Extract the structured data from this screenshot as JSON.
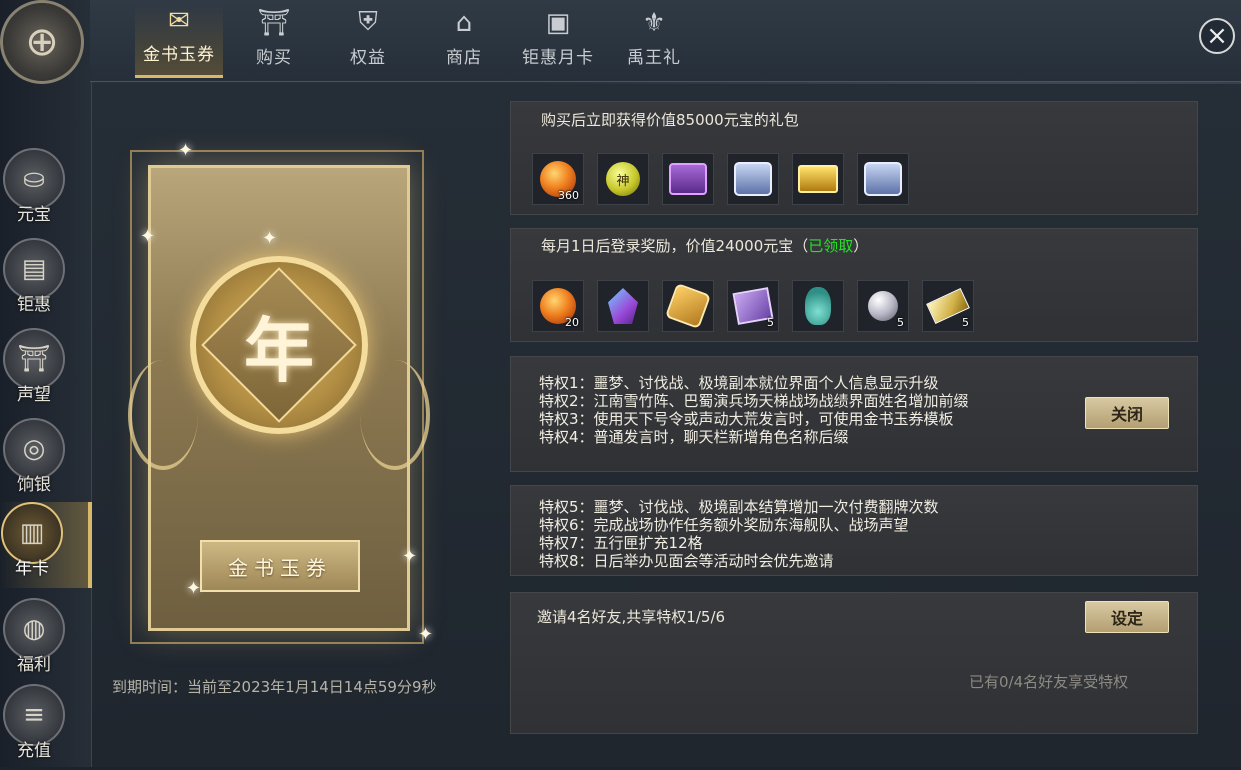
{
  "tabs": [
    {
      "label": "金书玉券",
      "icon": "scroll-icon",
      "glyph": "✉"
    },
    {
      "label": "购买",
      "icon": "gate-icon",
      "glyph": "⛩"
    },
    {
      "label": "权益",
      "icon": "shield-icon",
      "glyph": "⛨"
    },
    {
      "label": "商店",
      "icon": "shop-icon",
      "glyph": "⌂"
    },
    {
      "label": "钜惠月卡",
      "icon": "card-icon",
      "glyph": "▣"
    },
    {
      "label": "禹王礼",
      "icon": "crest-icon",
      "glyph": "⚜"
    }
  ],
  "sidebar": [
    {
      "label": "元宝",
      "icon": "ingot-icon",
      "glyph": "⛀"
    },
    {
      "label": "钜惠",
      "icon": "giftbox-icon",
      "glyph": "▤"
    },
    {
      "label": "声望",
      "icon": "pavilion-icon",
      "glyph": "⛩"
    },
    {
      "label": "饷银",
      "icon": "coin-icon",
      "glyph": "◎"
    },
    {
      "label": "年卡",
      "icon": "card-icon",
      "glyph": "▥"
    },
    {
      "label": "福利",
      "icon": "pouch-icon",
      "glyph": "◍"
    },
    {
      "label": "充值",
      "icon": "coin-stack-icon",
      "glyph": "≡"
    }
  ],
  "card": {
    "center_char": "年",
    "plaque": "金书玉券"
  },
  "expire_text": "到期时间：当前至2023年1月14日14点59分9秒",
  "gift_panel": {
    "title": "购买后立即获得价值85000元宝的礼包",
    "items": [
      {
        "icon": "fire-orb-icon",
        "count": "360"
      },
      {
        "icon": "god-orb-icon",
        "count": "",
        "char": "神"
      },
      {
        "icon": "purple-chest-icon",
        "count": ""
      },
      {
        "icon": "blue-chest-icon",
        "count": ""
      },
      {
        "icon": "gold-chest-icon",
        "count": ""
      },
      {
        "icon": "blue-chest-icon",
        "count": ""
      }
    ]
  },
  "monthly_panel": {
    "title_prefix": "每月1日后登录奖励，价值24000元宝（",
    "status": "已领取",
    "title_suffix": "）",
    "items": [
      {
        "icon": "fire-orb-icon",
        "count": "20"
      },
      {
        "icon": "crystal-icon",
        "count": ""
      },
      {
        "icon": "gold-token-icon",
        "count": ""
      },
      {
        "icon": "purple-scroll-icon",
        "count": "5"
      },
      {
        "icon": "jade-vase-icon",
        "count": ""
      },
      {
        "icon": "pearl-icon",
        "count": "5"
      },
      {
        "icon": "gold-bar-icon",
        "count": "5"
      }
    ]
  },
  "privileges_a": {
    "lines": [
      "特权1：噩梦、讨伐战、极境副本就位界面个人信息显示升级",
      "特权2：江南雪竹阵、巴蜀演兵场天梯战场战绩界面姓名增加前缀",
      "特权3：使用天下号令或声动大荒发言时，可使用金书玉券模板",
      "特权4：普通发言时，聊天栏新增角色名称后缀"
    ],
    "button": "关闭"
  },
  "privileges_b": {
    "lines": [
      "特权5：噩梦、讨伐战、极境副本结算增加一次付费翻牌次数",
      "特权6：完成战场协作任务额外奖励东海舰队、战场声望",
      "特权7：五行匣扩充12格",
      "特权8：日后举办见面会等活动时会优先邀请"
    ]
  },
  "invite_panel": {
    "title": "邀请4名好友,共享特权1/5/6",
    "button": "设定",
    "status": "已有0/4名好友享受特权"
  },
  "colors": {
    "accent_gold": "#d8b86a",
    "claimed_green": "#27e027",
    "button_bg": "#c9b78a"
  }
}
